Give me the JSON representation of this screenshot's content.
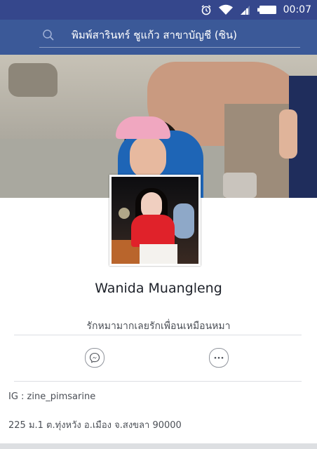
{
  "status_bar": {
    "time": "00:07",
    "icons": [
      "alarm-icon",
      "wifi-icon",
      "signal-icon",
      "battery-icon"
    ]
  },
  "header": {
    "search_text": "พิมพ์สารินทร์ ชูแก้ว  สาขาบัญชี  (ซิน)",
    "search_icon": "search-icon"
  },
  "profile": {
    "name": "Wanida Muangleng",
    "bio": "รักหมามากเลยรักเพื่อนเหมือนหมา"
  },
  "actions": [
    {
      "icon": "messenger-icon"
    },
    {
      "icon": "more-icon"
    }
  ],
  "info": {
    "instagram": "IG : zine_pimsarine",
    "address": "225 ม.1 ต.ทุ่งหวัง อ.เมือง จ.สงขลา 90000"
  },
  "colors": {
    "status_bar": "#35478c",
    "header": "#3b5998",
    "name_text": "#1d2129",
    "secondary_text": "#4b4f56"
  }
}
